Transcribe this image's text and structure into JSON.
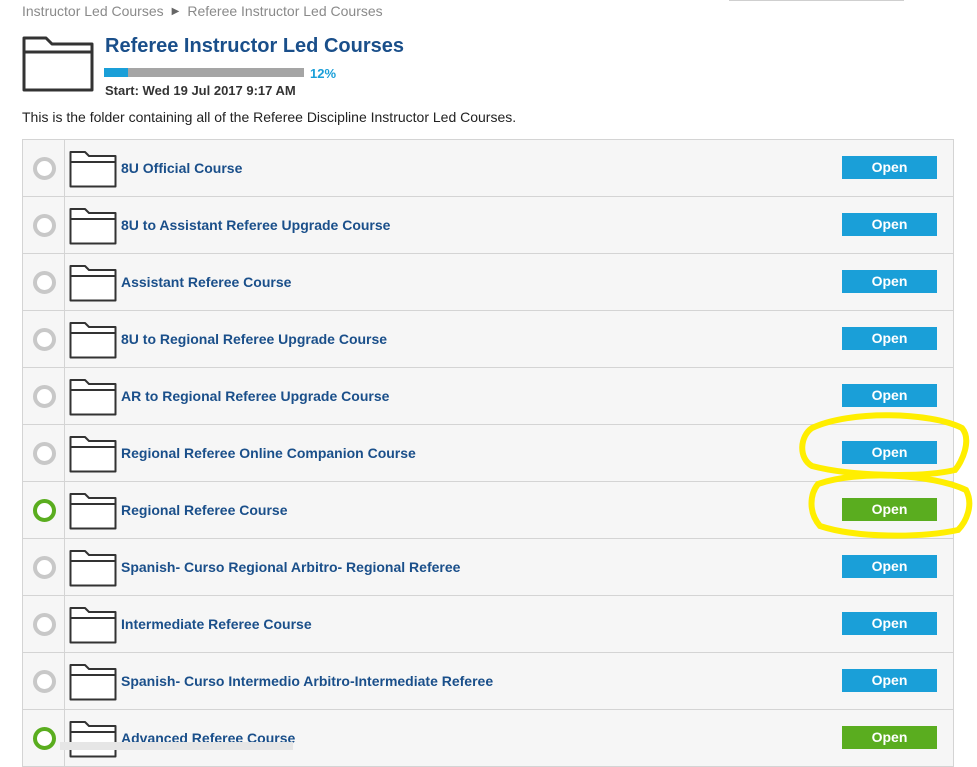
{
  "breadcrumb": {
    "items": [
      "Instructor Led Courses",
      "Referee Instructor Led Courses"
    ]
  },
  "header": {
    "folder_icon": "folder-icon",
    "title": "Referee Instructor Led Courses",
    "progress_percent": 12,
    "progress_label": "12%",
    "start": "Start: Wed 19 Jul 2017 9:17 AM",
    "description": "This is the folder containing all of the Referee Discipline Instructor Led Courses."
  },
  "colors": {
    "title": "#1a4f8a",
    "accent_blue": "#1a9fd8",
    "complete_green": "#5aad1f",
    "highlight_yellow": "#ffee00"
  },
  "courses": [
    {
      "name": "8U Official Course",
      "button": "Open",
      "completed": false
    },
    {
      "name": "8U to Assistant Referee Upgrade Course",
      "button": "Open",
      "completed": false
    },
    {
      "name": "Assistant Referee Course",
      "button": "Open",
      "completed": false
    },
    {
      "name": "8U to Regional Referee Upgrade Course",
      "button": "Open",
      "completed": false
    },
    {
      "name": "AR to Regional Referee Upgrade Course",
      "button": "Open",
      "completed": false
    },
    {
      "name": "Regional Referee Online Companion Course",
      "button": "Open",
      "completed": false
    },
    {
      "name": "Regional Referee Course",
      "button": "Open",
      "completed": true
    },
    {
      "name": "Spanish- Curso Regional Arbitro- Regional Referee",
      "button": "Open",
      "completed": false
    },
    {
      "name": "Intermediate Referee Course",
      "button": "Open",
      "completed": false
    },
    {
      "name": "Spanish- Curso Intermedio Arbitro-Intermediate Referee",
      "button": "Open",
      "completed": false
    },
    {
      "name": "Advanced Referee Course",
      "button": "Open",
      "completed": true
    }
  ]
}
